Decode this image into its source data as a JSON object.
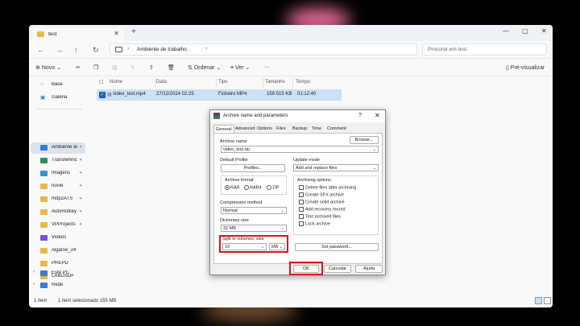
{
  "explorer": {
    "tab_title": "test",
    "tab_close": "✕",
    "new_tab": "+",
    "window_controls": [
      "—",
      "▢",
      "✕"
    ],
    "breadcrumb": "Ambiente de trabalho",
    "breadcrumb_sep": "›",
    "breadcrumb_more": "›",
    "search_placeholder": "Procurar em test",
    "toolbar": {
      "new": "Novo",
      "sort": "Ordenar",
      "view": "Ver",
      "more": "···",
      "preview": "Pré-visualizar"
    },
    "sidebar": {
      "home": "Base",
      "gallery": "Galeria",
      "items": [
        "Ambiente de",
        "Transferências",
        "Imagens",
        "nuvie",
        "mdp2ATS",
        "AutoHotkey",
        "VPProjects",
        "Videos",
        "Algarve_24",
        "PREPD",
        "LABDSOF"
      ],
      "this_pc": "Este PC",
      "network": "Rede"
    },
    "columns": [
      "Nome",
      "Data",
      "Tipo",
      "Tamanho",
      "Tempo"
    ],
    "file": {
      "name": "video_test.mp4",
      "date": "27/12/2024 02:25",
      "type": "Ficheiro MP4",
      "size": "159 515 KB",
      "duration": "01:12:40"
    },
    "status": {
      "count": "1 item",
      "selected": "1 item selecionado 155 MB"
    }
  },
  "dialog": {
    "title": "Archive name and parameters",
    "help": "?",
    "close": "✕",
    "tabs": [
      "General",
      "Advanced",
      "Options",
      "Files",
      "Backup",
      "Time",
      "Comment"
    ],
    "archive_name_label": "Archive name",
    "archive_name": "video_test.rar",
    "browse": "Browse...",
    "default_profile_label": "Default Profile",
    "profiles": "Profiles...",
    "update_mode_label": "Update mode",
    "update_mode": "Add and replace files",
    "archive_format_label": "Archive format",
    "formats": [
      "RAR",
      "RAR4",
      "ZIP"
    ],
    "compression_label": "Compression method",
    "compression": "Normal",
    "dictionary_label": "Dictionary size",
    "dictionary": "32 MB",
    "split_label": "Split to volumes, size",
    "split_value": "10",
    "split_unit": "MB",
    "archiving_options_label": "Archiving options",
    "options": [
      "Delete files after archiving",
      "Create SFX archive",
      "Create solid archive",
      "Add recovery record",
      "Test archived files",
      "Lock archive"
    ],
    "set_password": "Set password...",
    "ok": "OK",
    "cancel": "Cancelar",
    "help_btn": "Ajuda"
  }
}
